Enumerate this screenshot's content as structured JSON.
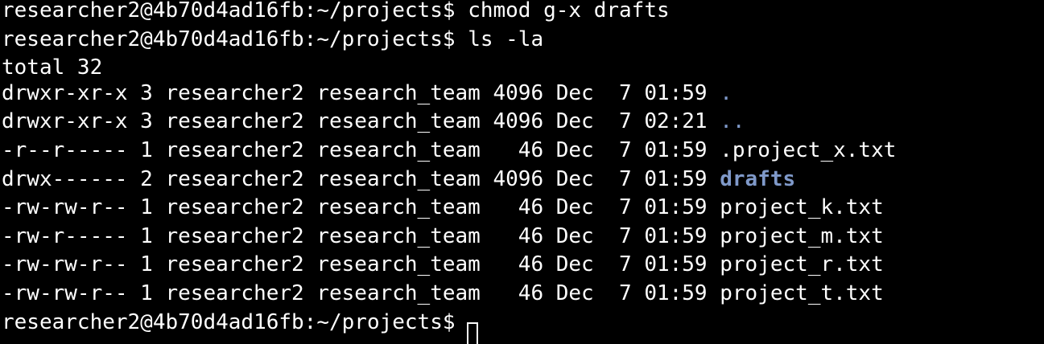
{
  "terminal": {
    "prompt": "researcher2@4b70d4ad16fb:~/projects$",
    "commands": [
      "chmod g-x drafts",
      "ls -la"
    ],
    "total_line": "total 32",
    "listing": [
      {
        "perms": "drwxr-xr-x",
        "links": "3",
        "owner": "researcher2",
        "group": "research_team",
        "size": "4096",
        "month": "Dec",
        "day": "7",
        "time": "01:59",
        "name": ".",
        "type": "dir"
      },
      {
        "perms": "drwxr-xr-x",
        "links": "3",
        "owner": "researcher2",
        "group": "research_team",
        "size": "4096",
        "month": "Dec",
        "day": "7",
        "time": "02:21",
        "name": "..",
        "type": "dir"
      },
      {
        "perms": "-r--r-----",
        "links": "1",
        "owner": "researcher2",
        "group": "research_team",
        "size": "46",
        "month": "Dec",
        "day": "7",
        "time": "01:59",
        "name": ".project_x.txt",
        "type": "file"
      },
      {
        "perms": "drwx------",
        "links": "2",
        "owner": "researcher2",
        "group": "research_team",
        "size": "4096",
        "month": "Dec",
        "day": "7",
        "time": "01:59",
        "name": "drafts",
        "type": "dir-bold"
      },
      {
        "perms": "-rw-rw-r--",
        "links": "1",
        "owner": "researcher2",
        "group": "research_team",
        "size": "46",
        "month": "Dec",
        "day": "7",
        "time": "01:59",
        "name": "project_k.txt",
        "type": "file"
      },
      {
        "perms": "-rw-r-----",
        "links": "1",
        "owner": "researcher2",
        "group": "research_team",
        "size": "46",
        "month": "Dec",
        "day": "7",
        "time": "01:59",
        "name": "project_m.txt",
        "type": "file"
      },
      {
        "perms": "-rw-rw-r--",
        "links": "1",
        "owner": "researcher2",
        "group": "research_team",
        "size": "46",
        "month": "Dec",
        "day": "7",
        "time": "01:59",
        "name": "project_r.txt",
        "type": "file"
      },
      {
        "perms": "-rw-rw-r--",
        "links": "1",
        "owner": "researcher2",
        "group": "research_team",
        "size": "46",
        "month": "Dec",
        "day": "7",
        "time": "01:59",
        "name": "project_t.txt",
        "type": "file"
      }
    ],
    "colors": {
      "background": "#000000",
      "text": "#ffffff",
      "directory": "#7f99c9"
    }
  }
}
